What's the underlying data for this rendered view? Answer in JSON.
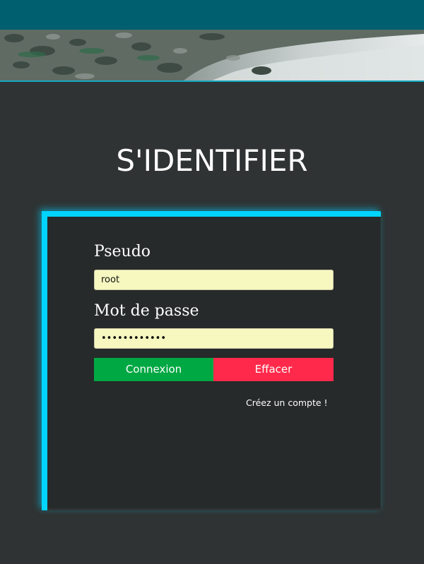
{
  "header": {
    "banner_image": "rocky riverbank with rushing water",
    "colors": {
      "top_bar": "#005f6e",
      "accent_line": "#14a9c0"
    }
  },
  "page_title": "S'IDENTIFIER",
  "form": {
    "username_label": "Pseudo",
    "username_value": "root",
    "password_label": "Mot de passe",
    "password_mask": "••••••••••••",
    "submit_label": "Connexion",
    "reset_label": "Effacer",
    "signup_link": "Créez un compte !"
  },
  "colors": {
    "background": "#2f3333",
    "panel": "#262a2a",
    "panel_glow": "#00d4ff",
    "input_bg": "#f6f8c0",
    "submit_bg": "#00a843",
    "reset_bg": "#ff2a4b"
  }
}
